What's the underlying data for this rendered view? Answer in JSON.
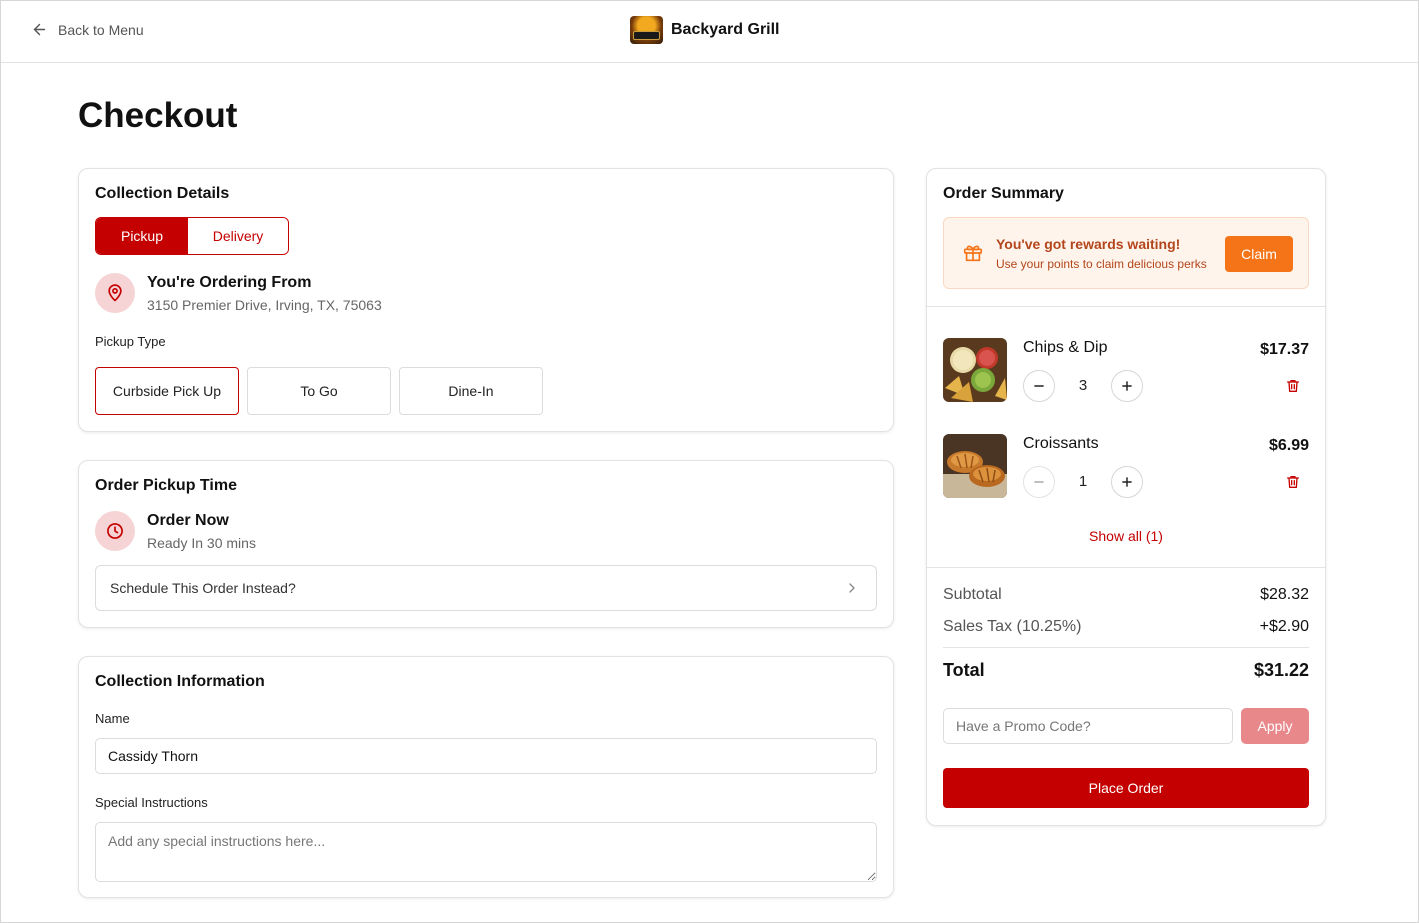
{
  "header": {
    "back_label": "Back to Menu",
    "brand_name": "Backyard Grill"
  },
  "page": {
    "title": "Checkout"
  },
  "collection_details": {
    "title": "Collection Details",
    "modes": [
      "Pickup",
      "Delivery"
    ],
    "selected_mode": "Pickup",
    "ordering_from_title": "You're Ordering From",
    "address": "3150 Premier Drive, Irving, TX, 75063",
    "pickup_type_label": "Pickup Type",
    "pickup_types": [
      "Curbside Pick Up",
      "To Go",
      "Dine-In"
    ],
    "selected_pickup_type": "Curbside Pick Up"
  },
  "pickup_time": {
    "title": "Order Pickup Time",
    "option_title": "Order Now",
    "option_sub": "Ready In 30 mins",
    "schedule_label": "Schedule This Order Instead?"
  },
  "collection_info": {
    "title": "Collection Information",
    "name_label": "Name",
    "name_value": "Cassidy Thorn",
    "instructions_label": "Special Instructions",
    "instructions_placeholder": "Add any special instructions here..."
  },
  "order_summary": {
    "title": "Order Summary",
    "rewards": {
      "title": "You've got rewards waiting!",
      "subtitle": "Use your points to claim delicious perks",
      "claim_label": "Claim"
    },
    "items": [
      {
        "name": "Chips & Dip",
        "price": "$17.37",
        "qty": "3"
      },
      {
        "name": "Croissants",
        "price": "$6.99",
        "qty": "1"
      }
    ],
    "show_all_label": "Show all (1)",
    "subtotal_label": "Subtotal",
    "subtotal_value": "$28.32",
    "tax_label": "Sales Tax (10.25%)",
    "tax_value": "+$2.90",
    "total_label": "Total",
    "total_value": "$31.22",
    "promo_placeholder": "Have a Promo Code?",
    "apply_label": "Apply",
    "place_order_label": "Place Order"
  },
  "colors": {
    "primary": "#c50000",
    "primary_light": "#f6d3d4",
    "reward_accent": "#f47417",
    "apply_disabled": "#e8888b"
  }
}
